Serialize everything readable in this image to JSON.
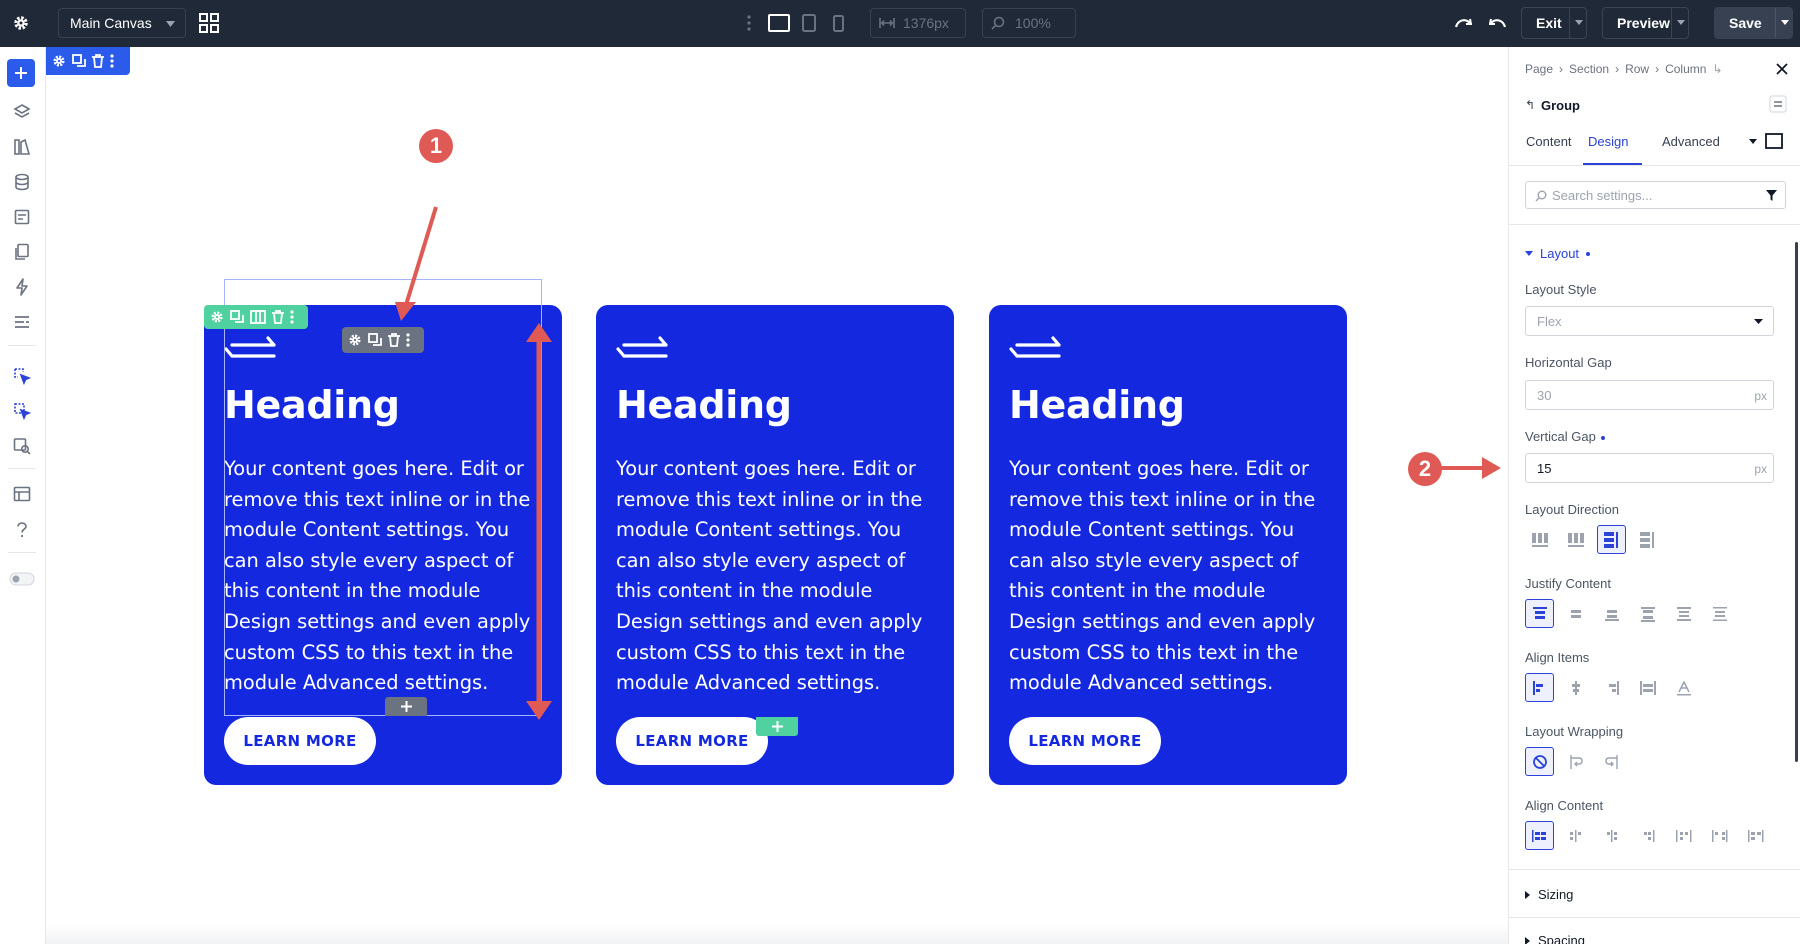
{
  "topbar": {
    "canvas_select": "Main Canvas",
    "width_value": "1376px",
    "zoom_value": "100%",
    "exit_label": "Exit",
    "preview_label": "Preview",
    "save_label": "Save"
  },
  "cards": [
    {
      "heading": "Heading",
      "body": "Your content goes here. Edit or remove this text inline or in the module Content settings. You can also style every aspect of this content in the module Design settings and even apply custom CSS to this text in the module Advanced settings.",
      "button": "LEARN MORE"
    },
    {
      "heading": "Heading",
      "body": "Your content goes here. Edit or remove this text inline or in the module Content settings. You can also style every aspect of this content in the module Design settings and even apply custom CSS to this text in the module Advanced settings.",
      "button": "LEARN MORE"
    },
    {
      "heading": "Heading",
      "body": "Your content goes here. Edit or remove this text inline or in the module Content settings. You can also style every aspect of this content in the module Design settings and even apply custom CSS to this text in the module Advanced settings.",
      "button": "LEARN MORE"
    }
  ],
  "annotations": {
    "callout_1": "1",
    "callout_2": "2"
  },
  "panel": {
    "breadcrumb": [
      "Page",
      "Section",
      "Row",
      "Column"
    ],
    "element_title": "Group",
    "tabs": [
      "Content",
      "Design",
      "Advanced"
    ],
    "active_tab": "Design",
    "search_placeholder": "Search settings...",
    "layout_section": "Layout",
    "layout_style_label": "Layout Style",
    "layout_style_value": "Flex",
    "horizontal_gap_label": "Horizontal Gap",
    "horizontal_gap_value": "30",
    "horizontal_gap_unit": "px",
    "vertical_gap_label": "Vertical Gap",
    "vertical_gap_value": "15",
    "vertical_gap_unit": "px",
    "layout_direction_label": "Layout Direction",
    "justify_content_label": "Justify Content",
    "align_items_label": "Align Items",
    "layout_wrapping_label": "Layout Wrapping",
    "align_content_label": "Align Content",
    "sizing_section": "Sizing",
    "spacing_section": "Spacing"
  },
  "colors": {
    "topbar_bg": "#1f2937",
    "card_blue": "#1428e0",
    "accent_blue": "#2b43d6",
    "module_green": "#4fd1a0",
    "annotation_red": "#e05a55"
  }
}
